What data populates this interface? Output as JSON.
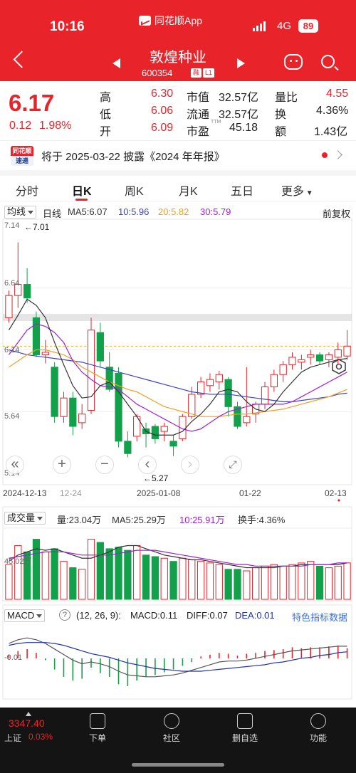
{
  "status_bar": {
    "time": "10:16",
    "app_name": "同花顺App",
    "network": "4G",
    "battery": "89"
  },
  "header": {
    "stock_name": "敦煌种业",
    "stock_code": "600354",
    "tag1": "融",
    "tag2": "L1"
  },
  "quote": {
    "price": "6.17",
    "change": "0.12",
    "change_pct": "1.98%",
    "high_label": "高",
    "high": "6.30",
    "low_label": "低",
    "low": "6.06",
    "open_label": "开",
    "open": "6.09",
    "mktcap_label": "市值",
    "mktcap": "32.57亿",
    "float_label": "流通",
    "float": "32.57亿",
    "pe_label": "市盈",
    "pe_sup": "TTM",
    "pe": "45.18",
    "vr_label": "量比",
    "vr": "4.55",
    "turnover_label": "换",
    "turnover": "4.36%",
    "amount_label": "额",
    "amount": "1.43亿"
  },
  "notice": {
    "badge_top": "同花顺",
    "badge_bottom": "速递",
    "text": "将于 2025-03-22 披露《2024 年年报》"
  },
  "tabs": [
    "分时",
    "日K",
    "周K",
    "月K",
    "五日",
    "更多"
  ],
  "kline": {
    "ma_select": "均线",
    "period": "日线",
    "ma5": "MA5:6.07",
    "ma10": "10:5.96",
    "ma20": "20:5.82",
    "ma30": "30:5.79",
    "adjust": "前复权",
    "y_top": "7.14",
    "y_mid1": "6.64",
    "y_mid2": "6.14",
    "y_mid3": "5.64",
    "y_bot": "5.14",
    "max_label": "←7.01",
    "min_label": "←5.27",
    "dates": [
      "2024-12-13",
      "12-24",
      "2025-01-08",
      "01-22",
      "02-13"
    ]
  },
  "volume": {
    "select": "成交量",
    "vol": "量:23.04万",
    "ma5": "MA5:25.29万",
    "ma10": "10:25.91万",
    "turnover": "换手:4.36%",
    "y_label": "45.02万"
  },
  "macd": {
    "select": "MACD",
    "help": "?",
    "params": "(12, 26, 9):",
    "macd": "MACD:0.11",
    "diff": "DIFF:0.07",
    "dea": "DEA:0.01",
    "special": "特色指标数据",
    "y_label": "-0.01"
  },
  "bottom": {
    "index_value": "3347.40",
    "index_name": "上证",
    "index_pct": "0.03%",
    "buttons": [
      "下单",
      "社区",
      "删自选",
      "功能"
    ]
  },
  "colors": {
    "up": "#e8232a",
    "down": "#12a14a",
    "ma5": "#333333",
    "ma10": "#3a45c8",
    "ma20": "#f0a020",
    "ma30": "#a020d8"
  },
  "chart_data": {
    "type": "candlestick",
    "dates": [
      "2024-12-13",
      "12-16",
      "12-17",
      "12-18",
      "12-19",
      "12-20",
      "12-23",
      "12-24",
      "12-25",
      "12-26",
      "12-27",
      "12-30",
      "12-31",
      "01-02",
      "01-03",
      "01-06",
      "01-07",
      "01-08",
      "01-09",
      "01-10",
      "01-13",
      "01-14",
      "01-15",
      "01-16",
      "01-17",
      "01-20",
      "01-21",
      "01-22",
      "01-23",
      "01-24",
      "01-27",
      "02-05",
      "02-06",
      "02-07",
      "02-10",
      "02-11",
      "02-12",
      "02-13"
    ],
    "ohlc": [
      [
        6.4,
        6.62,
        6.36,
        6.58
      ],
      [
        6.58,
        7.01,
        6.48,
        6.67
      ],
      [
        6.67,
        6.8,
        6.52,
        6.56
      ],
      [
        6.4,
        6.45,
        6.08,
        6.1
      ],
      [
        6.1,
        6.22,
        6.03,
        6.12
      ],
      [
        6.0,
        6.04,
        5.55,
        5.6
      ],
      [
        5.6,
        5.8,
        5.55,
        5.75
      ],
      [
        5.75,
        5.8,
        5.45,
        5.52
      ],
      [
        5.55,
        5.7,
        5.5,
        5.62
      ],
      [
        5.65,
        6.4,
        5.62,
        6.3
      ],
      [
        6.28,
        6.36,
        6.0,
        6.05
      ],
      [
        6.0,
        6.12,
        5.8,
        5.82
      ],
      [
        5.95,
        6.0,
        5.35,
        5.4
      ],
      [
        5.4,
        5.48,
        5.27,
        5.3
      ],
      [
        5.44,
        5.62,
        5.4,
        5.6
      ],
      [
        5.5,
        5.55,
        5.35,
        5.46
      ],
      [
        5.52,
        5.54,
        5.38,
        5.42
      ],
      [
        5.48,
        5.55,
        5.4,
        5.52
      ],
      [
        5.4,
        5.45,
        5.28,
        5.36
      ],
      [
        5.42,
        5.62,
        5.4,
        5.6
      ],
      [
        5.6,
        5.84,
        5.58,
        5.78
      ],
      [
        5.78,
        5.92,
        5.75,
        5.88
      ],
      [
        5.85,
        5.95,
        5.8,
        5.9
      ],
      [
        5.88,
        5.97,
        5.82,
        5.94
      ],
      [
        5.9,
        5.92,
        5.6,
        5.68
      ],
      [
        5.68,
        5.72,
        5.5,
        5.52
      ],
      [
        5.55,
        6.0,
        5.52,
        5.6
      ],
      [
        5.62,
        5.72,
        5.55,
        5.7
      ],
      [
        5.7,
        5.88,
        5.66,
        5.84
      ],
      [
        5.84,
        5.98,
        5.8,
        5.94
      ],
      [
        5.94,
        6.05,
        5.88,
        6.02
      ],
      [
        6.02,
        6.12,
        5.98,
        6.08
      ],
      [
        6.04,
        6.1,
        5.98,
        6.06
      ],
      [
        6.08,
        6.14,
        6.02,
        6.1
      ],
      [
        6.1,
        6.12,
        6.02,
        6.05
      ],
      [
        6.06,
        6.12,
        6.0,
        6.1
      ],
      [
        6.08,
        6.2,
        6.02,
        6.14
      ],
      [
        6.09,
        6.3,
        6.06,
        6.17
      ]
    ],
    "ma5": [
      6.3,
      6.42,
      6.55,
      6.5,
      6.4,
      6.2,
      6.02,
      5.85,
      5.75,
      5.76,
      5.85,
      5.88,
      5.8,
      5.7,
      5.6,
      5.48,
      5.45,
      5.45,
      5.45,
      5.48,
      5.56,
      5.62,
      5.7,
      5.8,
      5.82,
      5.8,
      5.72,
      5.66,
      5.64,
      5.7,
      5.8,
      5.88,
      5.96,
      6.0,
      6.02,
      6.04,
      6.06,
      6.07
    ],
    "ma10": [
      6.1,
      6.2,
      6.3,
      6.35,
      6.33,
      6.28,
      6.2,
      6.05,
      5.96,
      5.9,
      5.85,
      5.84,
      5.82,
      5.76,
      5.7,
      5.66,
      5.62,
      5.58,
      5.54,
      5.5,
      5.48,
      5.5,
      5.55,
      5.6,
      5.64,
      5.66,
      5.68,
      5.7,
      5.7,
      5.7,
      5.7,
      5.72,
      5.76,
      5.8,
      5.84,
      5.88,
      5.92,
      5.96
    ],
    "ma20": [
      6.0,
      6.05,
      6.1,
      6.14,
      6.14,
      6.12,
      6.1,
      6.06,
      6.0,
      5.96,
      5.92,
      5.88,
      5.85,
      5.82,
      5.8,
      5.76,
      5.72,
      5.68,
      5.66,
      5.64,
      5.62,
      5.6,
      5.6,
      5.6,
      5.61,
      5.62,
      5.62,
      5.63,
      5.64,
      5.65,
      5.66,
      5.68,
      5.7,
      5.72,
      5.74,
      5.76,
      5.79,
      5.82
    ],
    "ma30": [
      6.14,
      6.12,
      6.1,
      6.09,
      6.08,
      6.07,
      6.06,
      6.05,
      6.04,
      6.02,
      6.0,
      5.98,
      5.96,
      5.94,
      5.92,
      5.9,
      5.88,
      5.86,
      5.84,
      5.82,
      5.8,
      5.79,
      5.78,
      5.78,
      5.78,
      5.77,
      5.76,
      5.75,
      5.74,
      5.73,
      5.72,
      5.72,
      5.73,
      5.74,
      5.75,
      5.76,
      5.78,
      5.79
    ],
    "volume": [
      22,
      34,
      30,
      38,
      30,
      32,
      24,
      20,
      19,
      38,
      36,
      32,
      33,
      31,
      34,
      28,
      27,
      26,
      24,
      26,
      25,
      24,
      23,
      22,
      19,
      19,
      18,
      20,
      21,
      22,
      21,
      22,
      23,
      24,
      21,
      20,
      21,
      23.04
    ],
    "vol_ma5": [
      24,
      28,
      30,
      32,
      31,
      32,
      30,
      28,
      26,
      26,
      28,
      30,
      33,
      34,
      34,
      32,
      30,
      28,
      27,
      26,
      25,
      25,
      24,
      23,
      22,
      21,
      20,
      20,
      20,
      20,
      21,
      21,
      22,
      22,
      22,
      22,
      22,
      23
    ],
    "vol_ma10": [
      26,
      27,
      28,
      29,
      30,
      30,
      30,
      29,
      28,
      28,
      28,
      28,
      29,
      30,
      31,
      31,
      31,
      30,
      29,
      28,
      27,
      26,
      25,
      24,
      23,
      22,
      22,
      21,
      21,
      21,
      21,
      21,
      21,
      22,
      22,
      22,
      23,
      23
    ],
    "macd_hist": [
      0.04,
      0.08,
      0.1,
      0.06,
      -0.02,
      -0.12,
      -0.2,
      -0.24,
      -0.22,
      -0.1,
      -0.16,
      -0.2,
      -0.28,
      -0.3,
      -0.24,
      -0.2,
      -0.18,
      -0.15,
      -0.12,
      -0.08,
      -0.04,
      0.02,
      0.04,
      0.06,
      0.05,
      0.03,
      0.05,
      0.06,
      0.08,
      0.09,
      0.1,
      0.12,
      0.11,
      0.12,
      0.12,
      0.13,
      0.14,
      0.11
    ],
    "diff": [
      0.1,
      0.14,
      0.16,
      0.14,
      0.1,
      0.04,
      -0.02,
      -0.08,
      -0.12,
      -0.1,
      -0.12,
      -0.15,
      -0.2,
      -0.24,
      -0.25,
      -0.26,
      -0.26,
      -0.25,
      -0.24,
      -0.22,
      -0.19,
      -0.16,
      -0.13,
      -0.1,
      -0.09,
      -0.09,
      -0.08,
      -0.06,
      -0.04,
      -0.02,
      0.0,
      0.02,
      0.03,
      0.04,
      0.05,
      0.06,
      0.07,
      0.07
    ],
    "dea": [
      0.08,
      0.1,
      0.11,
      0.11,
      0.11,
      0.1,
      0.08,
      0.05,
      0.02,
      -0.01,
      -0.03,
      -0.05,
      -0.08,
      -0.11,
      -0.13,
      -0.15,
      -0.17,
      -0.18,
      -0.19,
      -0.2,
      -0.2,
      -0.2,
      -0.19,
      -0.18,
      -0.17,
      -0.16,
      -0.15,
      -0.14,
      -0.13,
      -0.11,
      -0.1,
      -0.08,
      -0.06,
      -0.05,
      -0.03,
      -0.02,
      0.0,
      0.01
    ],
    "ylim_price": [
      5.14,
      7.14
    ],
    "ylim_volume": [
      0,
      45.02
    ]
  }
}
